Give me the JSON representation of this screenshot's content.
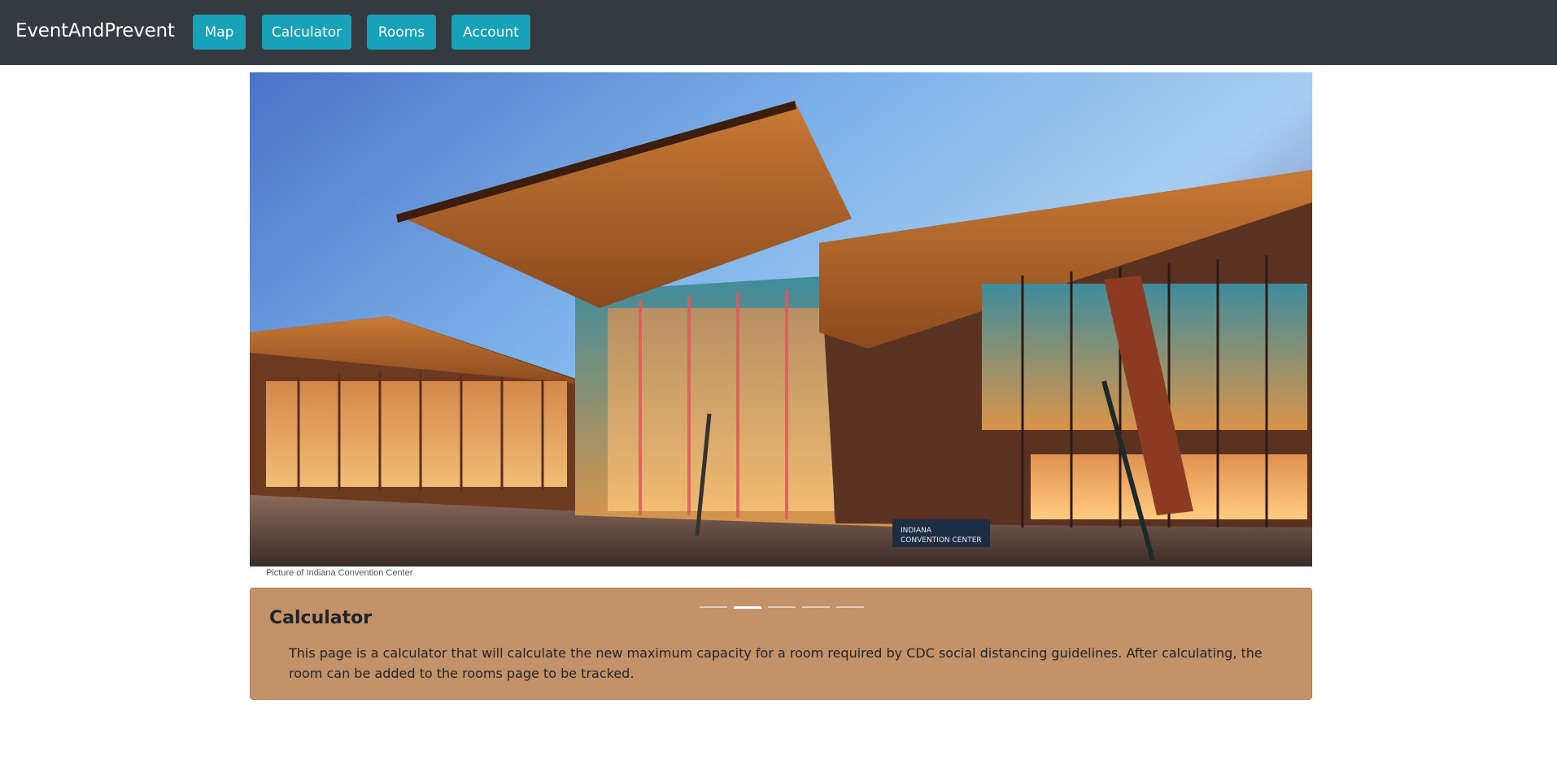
{
  "navbar": {
    "brand": "EventAndPrevent",
    "buttons": [
      "Map",
      "Calculator",
      "Rooms",
      "Account"
    ]
  },
  "hero": {
    "image_description": "Indiana Convention Center",
    "sign_text": [
      "INDIANA",
      "CONVENTION CENTER"
    ],
    "caption": "Picture of Indiana Convention Center"
  },
  "carousel": {
    "slide_count": 5,
    "active_index": 1
  },
  "panel": {
    "title": "Calculator",
    "text": "This page is a calculator that will calculate the new maximum capacity for a room required by CDC social distancing guidelines. After calculating, the room can be added to the rooms page to be tracked."
  },
  "colors": {
    "navbar": "#343a40",
    "button": "#17a2b8",
    "panel": "#c49268"
  }
}
